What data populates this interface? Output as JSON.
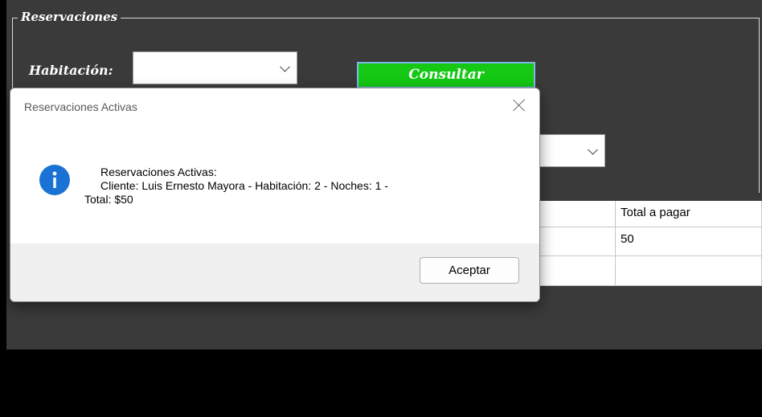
{
  "group": {
    "title": "Reservaciones"
  },
  "form": {
    "habitacion_label": "Habitación:",
    "habitacion_value": "",
    "consultar_label": "Consultar",
    "second_combo_value": ""
  },
  "grid": {
    "header_total": "Total a pagar",
    "row1_total": "50",
    "row2_total": ""
  },
  "dialog": {
    "title": "Reservaciones Activas",
    "message_line1": "Reservaciones Activas:",
    "message_line2": "Cliente: Luis Ernesto Mayora - Habitación: 2 - Noches: 1 -",
    "message_line3": "Total: $50",
    "ok_label": "Aceptar",
    "icon": "info-icon",
    "accent": "#1a73d4"
  },
  "colors": {
    "consultar_bg": "#14c814",
    "panel_bg": "#3a3a3a"
  }
}
